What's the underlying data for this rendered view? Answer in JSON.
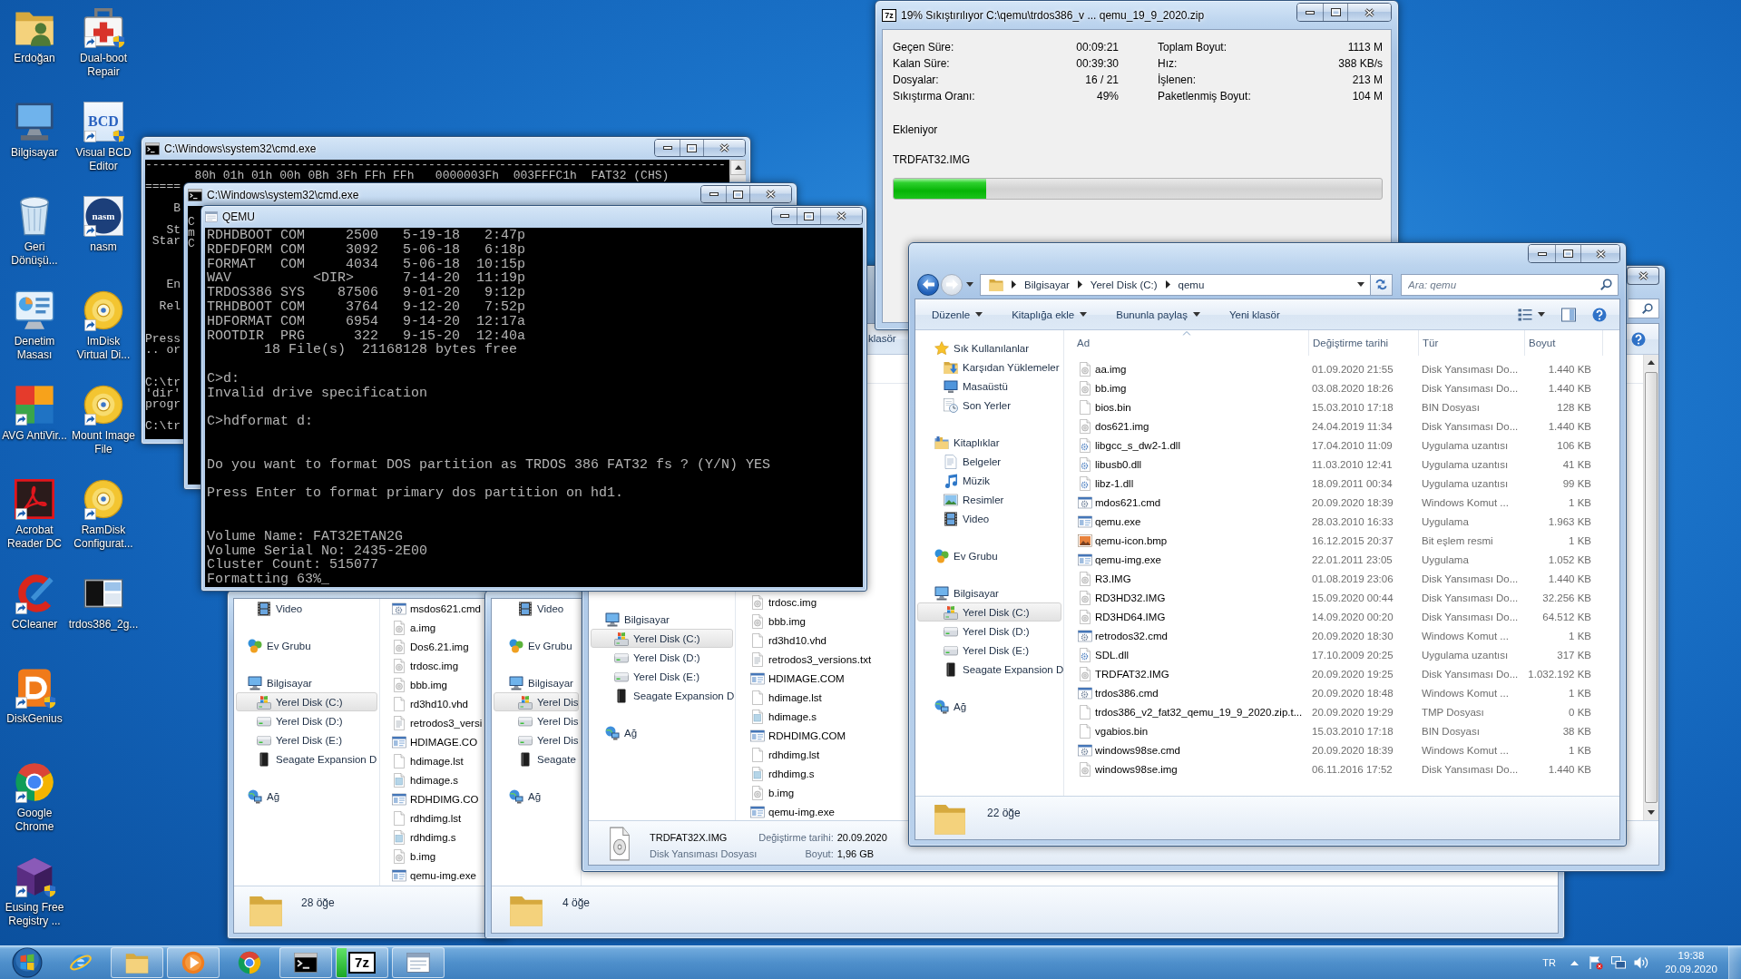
{
  "desktop_icon_columns": [
    {
      "icons": [
        {
          "label": "Erdoğan",
          "kind": "user-folder",
          "shortcut": false,
          "shield": false
        },
        {
          "label": "Bilgisayar",
          "kind": "computer",
          "shortcut": false,
          "shield": false
        },
        {
          "label": "Geri Dönüşü...",
          "kind": "recycle-bin",
          "shortcut": false,
          "shield": false
        },
        {
          "label": "Denetim Masası",
          "kind": "control-panel",
          "shortcut": false,
          "shield": false
        },
        {
          "label": "AVG AntiVir...",
          "kind": "avg",
          "shortcut": true,
          "shield": false
        },
        {
          "label": "Acrobat Reader DC",
          "kind": "acrobat",
          "shortcut": true,
          "shield": false
        },
        {
          "label": "CCleaner",
          "kind": "ccleaner",
          "shortcut": true,
          "shield": false
        },
        {
          "label": "DiskGenius",
          "kind": "diskgenius",
          "shortcut": true,
          "shield": true
        },
        {
          "label": "Google Chrome",
          "kind": "chrome",
          "shortcut": true,
          "shield": false
        },
        {
          "label": "Eusing Free Registry ...",
          "kind": "eusing",
          "shortcut": true,
          "shield": true
        }
      ]
    },
    {
      "icons": [
        {
          "label": "Dual-boot Repair",
          "kind": "toolbox",
          "shortcut": true,
          "shield": true
        },
        {
          "label": "Visual BCD Editor",
          "kind": "logo",
          "logo_text": "BCD",
          "shortcut": true,
          "shield": true
        },
        {
          "label": "nasm",
          "kind": "logo-round",
          "logo_text": "nasm",
          "shortcut": true,
          "shield": false
        },
        {
          "label": "ImDisk Virtual Di...",
          "kind": "disc",
          "shortcut": true,
          "shield": false
        },
        {
          "label": "Mount Image File",
          "kind": "disc",
          "shortcut": true,
          "shield": false
        },
        {
          "label": "RamDisk Configurat...",
          "kind": "disc",
          "shortcut": true,
          "shield": false
        },
        {
          "label": "trdos386_2g...",
          "kind": "screenshot",
          "shortcut": false,
          "shield": false
        }
      ]
    }
  ],
  "cmd_windows": [
    {
      "title": "C:\\Windows\\system32\\cmd.exe",
      "lines": [
        "----------------------------------------------------------------------------------",
        "80h 01h 01h 00h 0Bh 3Fh FFh FFh   0000003Fh  003FFFC1h  FAT32 (CHS)",
        "=====",
        "B",
        "St",
        "Star",
        "En",
        "Rel",
        "Press",
        ".. or",
        "C:\\tr",
        "'dir'",
        "progr",
        "C:\\tr"
      ]
    },
    {
      "title": "C:\\Windows\\system32\\cmd.exe",
      "lines": [
        "C",
        "m",
        "C"
      ]
    }
  ],
  "qemu_window": {
    "title": "QEMU",
    "lines": [
      "RDHDBOOT COM     2500   5-19-18   2:47p",
      "RDFDFORM COM     3092   5-06-18   6:18p",
      "FORMAT   COM     4034   5-06-18  10:15p",
      "WAV          <DIR>      7-14-20  11:19p",
      "TRDOS386 SYS    87506   9-01-20   9:12p",
      "TRHDBOOT COM     3764   9-12-20   7:52p",
      "HDFORMAT COM     6954   9-14-20  12:17a",
      "ROOTDIR  PRG      322   9-15-20  12:40a",
      "18 File(s)  21168128 bytes free",
      "C>d:",
      "Invalid drive specification",
      "C>hdformat d:",
      "Do you want to format DOS partition as TRDOS 386 FAT32 fs ? (Y/N) YES",
      "Press Enter to format primary dos partition on hd1.",
      "Volume Name: FAT32ETAN2G",
      "Volume Serial No: 2435-2E00",
      "Cluster Count: 515077",
      "Formatting 63%_"
    ]
  },
  "zip_window": {
    "logo_text": "7z",
    "title": "19% Sıkıştırılıyor C:\\qemu\\trdos386_v ... qemu_19_9_2020.zip",
    "stats_left": [
      {
        "label": "Geçen Süre:",
        "value": "00:09:21"
      },
      {
        "label": "Kalan Süre:",
        "value": "00:39:30"
      },
      {
        "label": "Dosyalar:",
        "value": "16 / 21"
      },
      {
        "label": "Sıkıştırma Oranı:",
        "value": "49%"
      }
    ],
    "stats_right": [
      {
        "label": "Toplam Boyut:",
        "value": "1113 M"
      },
      {
        "label": "Hız:",
        "value": "388 KB/s"
      },
      {
        "label": "İşlenen:",
        "value": "213 M"
      },
      {
        "label": "Paketlenmiş Boyut:",
        "value": "104 M"
      }
    ],
    "action": "Ekleniyor",
    "current_file": "TRDFAT32.IMG",
    "progress": {
      "level": 0.19
    }
  },
  "explorer_windows": [
    {
      "nav": [
        {
          "children": [
            {
              "label": "Video",
              "kind": "video",
              "selected": false
            }
          ]
        },
        {
          "label": "Ev Grubu",
          "kind": "homegroup",
          "selected": false
        },
        {
          "label": "Bilgisayar",
          "kind": "computer",
          "selected": false,
          "children": [
            {
              "label": "Yerel Disk (C:)",
              "kind": "system-drive",
              "selected": true
            },
            {
              "label": "Yerel Disk (D:)",
              "kind": "drive",
              "selected": false
            },
            {
              "label": "Yerel Disk (E:)",
              "kind": "drive",
              "selected": false
            },
            {
              "label": "Seagate Expansion D",
              "kind": "external-drive",
              "selected": false
            }
          ]
        },
        {
          "label": "Ağ",
          "kind": "network",
          "selected": false
        }
      ],
      "files": [
        {
          "name": "msdos621.cmd",
          "kind": "cmd"
        },
        {
          "name": "a.img",
          "kind": "disk-image"
        },
        {
          "name": "Dos6.21.img",
          "kind": "disk-image"
        },
        {
          "name": "trdosc.img",
          "kind": "disk-image"
        },
        {
          "name": "bbb.img",
          "kind": "disk-image"
        },
        {
          "name": "rd3hd10.vhd",
          "kind": "blank"
        },
        {
          "name": "retrodos3_versi",
          "kind": "text"
        },
        {
          "name": "HDIMAGE.CO",
          "kind": "exe"
        },
        {
          "name": "hdimage.lst",
          "kind": "blank"
        },
        {
          "name": "hdimage.s",
          "kind": "source"
        },
        {
          "name": "RDHDIMG.CO",
          "kind": "exe"
        },
        {
          "name": "rdhdimg.lst",
          "kind": "blank"
        },
        {
          "name": "rdhdimg.s",
          "kind": "source"
        },
        {
          "name": "b.img",
          "kind": "disk-image"
        },
        {
          "name": "qemu-img.exe",
          "kind": "exe"
        }
      ],
      "status": "28 öğe"
    },
    {
      "nav": [
        {
          "children": [
            {
              "label": "Video",
              "kind": "video",
              "selected": false
            }
          ]
        },
        {
          "label": "Ev Grubu",
          "kind": "homegroup",
          "selected": false
        },
        {
          "label": "Bilgisayar",
          "kind": "computer",
          "selected": false,
          "children": [
            {
              "label": "Yerel Dis",
              "kind": "system-drive",
              "selected": true
            },
            {
              "label": "Yerel Dis",
              "kind": "drive",
              "selected": false
            },
            {
              "label": "Yerel Dis",
              "kind": "drive",
              "selected": false
            },
            {
              "label": "Seagate",
              "kind": "external-drive",
              "selected": false
            }
          ]
        },
        {
          "label": "Ağ",
          "kind": "network",
          "selected": false
        }
      ],
      "status": "4 öğe"
    },
    {
      "toolbar_fragment": "klasör",
      "nav": [
        {
          "label": "Bilgisayar",
          "kind": "computer",
          "selected": false,
          "children": [
            {
              "label": "Yerel Disk (C:)",
              "kind": "system-drive",
              "selected": true
            },
            {
              "label": "Yerel Disk (D:)",
              "kind": "drive",
              "selected": false
            },
            {
              "label": "Yerel Disk (E:)",
              "kind": "drive",
              "selected": false
            },
            {
              "label": "Seagate Expansion D",
              "kind": "external-drive",
              "selected": false
            }
          ]
        },
        {
          "label": "Ağ",
          "kind": "network",
          "selected": false
        }
      ],
      "files": [
        {
          "name": "trdosc.img",
          "kind": "disk-image"
        },
        {
          "name": "bbb.img",
          "kind": "disk-image"
        },
        {
          "name": "rd3hd10.vhd",
          "kind": "blank"
        },
        {
          "name": "retrodos3_versions.txt",
          "kind": "text"
        },
        {
          "name": "HDIMAGE.COM",
          "kind": "exe"
        },
        {
          "name": "hdimage.lst",
          "kind": "blank"
        },
        {
          "name": "hdimage.s",
          "kind": "source"
        },
        {
          "name": "RDHDIMG.COM",
          "kind": "exe"
        },
        {
          "name": "rdhdimg.lst",
          "kind": "blank"
        },
        {
          "name": "rdhdimg.s",
          "kind": "source"
        },
        {
          "name": "b.img",
          "kind": "disk-image"
        },
        {
          "name": "qemu-img.exe",
          "kind": "exe"
        }
      ],
      "details": {
        "name": "TRDFAT32X.IMG",
        "type": "Disk Yansıması Dosyası",
        "fields": [
          {
            "label": "Değiştirme tarihi:",
            "value": "20.09.2020"
          },
          {
            "label": "Boyut:",
            "value": "1,96 GB"
          }
        ]
      }
    },
    {
      "nav_buttons": [
        {
          "kind": "back",
          "disabled": false
        },
        {
          "kind": "forward",
          "disabled": true
        }
      ],
      "address": [
        "Bilgisayar",
        "Yerel Disk (C:)",
        "qemu"
      ],
      "search_placeholder": "Ara: qemu",
      "toolbar": [
        {
          "label": "Düzenle",
          "dropdown": true
        },
        {
          "label": "Kitaplığa ekle",
          "dropdown": true
        },
        {
          "label": "Bununla paylaş",
          "dropdown": true
        },
        {
          "label": "Yeni klasör",
          "dropdown": false
        }
      ],
      "nav": [
        {
          "label": "Sık Kullanılanlar",
          "kind": "star",
          "selected": false,
          "children": [
            {
              "label": "Karşıdan Yüklemeler",
              "kind": "downloads",
              "selected": false
            },
            {
              "label": "Masaüstü",
              "kind": "desktop",
              "selected": false
            },
            {
              "label": "Son Yerler",
              "kind": "recent",
              "selected": false
            }
          ]
        },
        {
          "label": "Kitaplıklar",
          "kind": "library",
          "selected": false,
          "children": [
            {
              "label": "Belgeler",
              "kind": "documents",
              "selected": false
            },
            {
              "label": "Müzik",
              "kind": "music",
              "selected": false
            },
            {
              "label": "Resimler",
              "kind": "pictures",
              "selected": false
            },
            {
              "label": "Video",
              "kind": "video",
              "selected": false
            }
          ]
        },
        {
          "label": "Ev Grubu",
          "kind": "homegroup",
          "selected": false
        },
        {
          "label": "Bilgisayar",
          "kind": "computer",
          "selected": false,
          "children": [
            {
              "label": "Yerel Disk (C:)",
              "kind": "system-drive",
              "selected": true
            },
            {
              "label": "Yerel Disk (D:)",
              "kind": "drive",
              "selected": false
            },
            {
              "label": "Yerel Disk (E:)",
              "kind": "drive",
              "selected": false
            },
            {
              "label": "Seagate Expansion D",
              "kind": "external-drive",
              "selected": false
            }
          ]
        },
        {
          "label": "Ağ",
          "kind": "network",
          "selected": false
        }
      ],
      "columns": [
        {
          "label": "Ad",
          "sorted": true
        },
        {
          "label": "Değiştirme tarihi",
          "sorted": false
        },
        {
          "label": "Tür",
          "sorted": false
        },
        {
          "label": "Boyut",
          "sorted": false
        }
      ],
      "files": [
        {
          "name": "aa.img",
          "date": "01.09.2020 21:55",
          "type": "Disk Yansıması Do...",
          "size": "1.440 KB",
          "kind": "disk-image"
        },
        {
          "name": "bb.img",
          "date": "03.08.2020 18:26",
          "type": "Disk Yansıması Do...",
          "size": "1.440 KB",
          "kind": "disk-image"
        },
        {
          "name": "bios.bin",
          "date": "15.03.2010 17:18",
          "type": "BIN Dosyası",
          "size": "128 KB",
          "kind": "blank"
        },
        {
          "name": "dos621.img",
          "date": "24.04.2019 11:34",
          "type": "Disk Yansıması Do...",
          "size": "1.440 KB",
          "kind": "disk-image"
        },
        {
          "name": "libgcc_s_dw2-1.dll",
          "date": "17.04.2010 11:09",
          "type": "Uygulama uzantısı",
          "size": "106 KB",
          "kind": "dll"
        },
        {
          "name": "libusb0.dll",
          "date": "11.03.2010 12:41",
          "type": "Uygulama uzantısı",
          "size": "41 KB",
          "kind": "dll"
        },
        {
          "name": "libz-1.dll",
          "date": "18.09.2011 00:34",
          "type": "Uygulama uzantısı",
          "size": "99 KB",
          "kind": "dll"
        },
        {
          "name": "mdos621.cmd",
          "date": "20.09.2020 18:39",
          "type": "Windows Komut ...",
          "size": "1 KB",
          "kind": "cmd"
        },
        {
          "name": "qemu.exe",
          "date": "28.03.2010 16:33",
          "type": "Uygulama",
          "size": "1.963 KB",
          "kind": "exe"
        },
        {
          "name": "qemu-icon.bmp",
          "date": "16.12.2015 20:37",
          "type": "Bit eşlem resmi",
          "size": "1 KB",
          "kind": "bmp"
        },
        {
          "name": "qemu-img.exe",
          "date": "22.01.2011 23:05",
          "type": "Uygulama",
          "size": "1.052 KB",
          "kind": "exe"
        },
        {
          "name": "R3.IMG",
          "date": "01.08.2019 23:06",
          "type": "Disk Yansıması Do...",
          "size": "1.440 KB",
          "kind": "disk-image"
        },
        {
          "name": "RD3HD32.IMG",
          "date": "15.09.2020 00:44",
          "type": "Disk Yansıması Do...",
          "size": "32.256 KB",
          "kind": "disk-image"
        },
        {
          "name": "RD3HD64.IMG",
          "date": "14.09.2020 00:20",
          "type": "Disk Yansıması Do...",
          "size": "64.512 KB",
          "kind": "disk-image"
        },
        {
          "name": "retrodos32.cmd",
          "date": "20.09.2020 18:30",
          "type": "Windows Komut ...",
          "size": "1 KB",
          "kind": "cmd"
        },
        {
          "name": "SDL.dll",
          "date": "17.10.2009 20:25",
          "type": "Uygulama uzantısı",
          "size": "317 KB",
          "kind": "dll"
        },
        {
          "name": "TRDFAT32.IMG",
          "date": "20.09.2020 19:25",
          "type": "Disk Yansıması Do...",
          "size": "1.032.192 KB",
          "kind": "disk-image"
        },
        {
          "name": "trdos386.cmd",
          "date": "20.09.2020 18:48",
          "type": "Windows Komut ...",
          "size": "1 KB",
          "kind": "cmd"
        },
        {
          "name": "trdos386_v2_fat32_qemu_19_9_2020.zip.t...",
          "date": "20.09.2020 19:29",
          "type": "TMP Dosyası",
          "size": "0 KB",
          "kind": "blank"
        },
        {
          "name": "vgabios.bin",
          "date": "15.03.2010 17:18",
          "type": "BIN Dosyası",
          "size": "38 KB",
          "kind": "blank"
        },
        {
          "name": "windows98se.cmd",
          "date": "20.09.2020 18:39",
          "type": "Windows Komut ...",
          "size": "1 KB",
          "kind": "cmd"
        },
        {
          "name": "windows98se.img",
          "date": "06.11.2016 17:52",
          "type": "Disk Yansıması Do...",
          "size": "1.440 KB",
          "kind": "disk-image"
        }
      ],
      "status": "22 öğe"
    }
  ],
  "taskbar": {
    "items": [
      {
        "kind": "ie",
        "running": false
      },
      {
        "kind": "explorer",
        "running": true
      },
      {
        "kind": "media",
        "running": true
      },
      {
        "kind": "chrome",
        "running": false
      },
      {
        "kind": "cmd",
        "running": true
      },
      {
        "kind": "archiver",
        "running": true,
        "logo_text": "7z",
        "level": 0.19
      },
      {
        "kind": "qemu",
        "running": true
      }
    ],
    "tray": {
      "language": "TR",
      "time": "19:38",
      "date": "20.09.2020"
    }
  }
}
